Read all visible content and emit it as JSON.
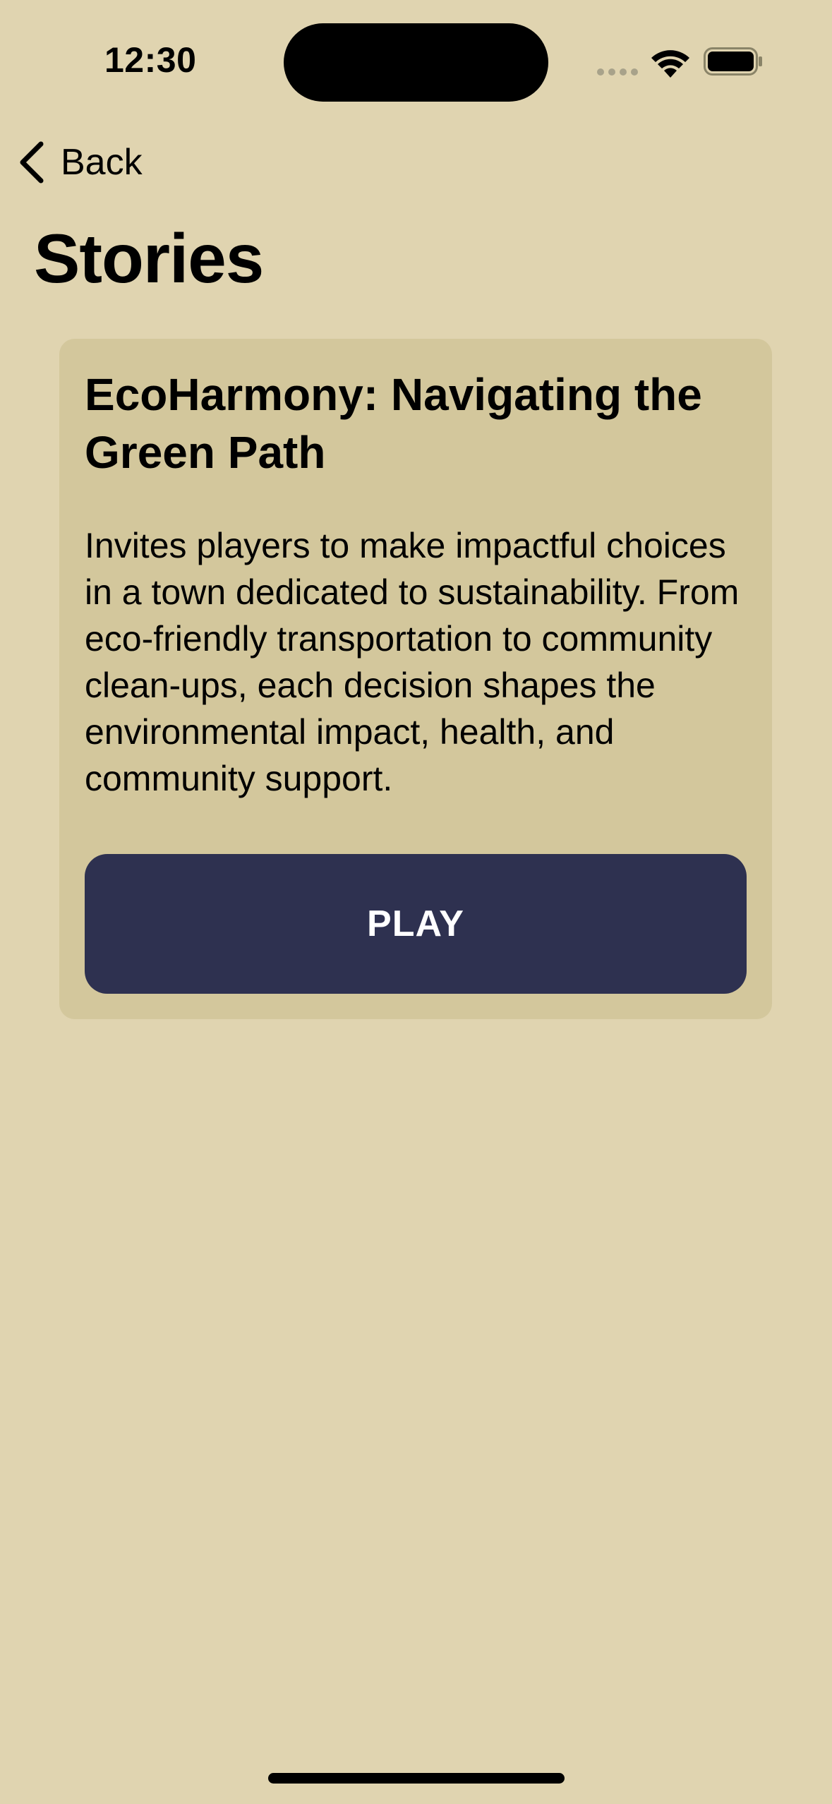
{
  "status_bar": {
    "time": "12:30",
    "signal_icon": "cellular-signal-dots-icon",
    "wifi_icon": "wifi-icon",
    "battery_icon": "battery-icon"
  },
  "nav": {
    "back_label": "Back",
    "back_icon": "chevron-left-icon"
  },
  "page": {
    "title": "Stories"
  },
  "stories": [
    {
      "title": "EcoHarmony: Navigating the Green Path",
      "description": "Invites players to make impactful choices in a town dedicated to sustainability. From eco-friendly transportation to community clean-ups, each decision shapes the environmental impact, health, and community support.",
      "play_label": "PLAY"
    }
  ],
  "colors": {
    "background": "#e0d4b0",
    "card": "#d3c79c",
    "play_button": "#2e3150",
    "play_text": "#ffffff"
  }
}
